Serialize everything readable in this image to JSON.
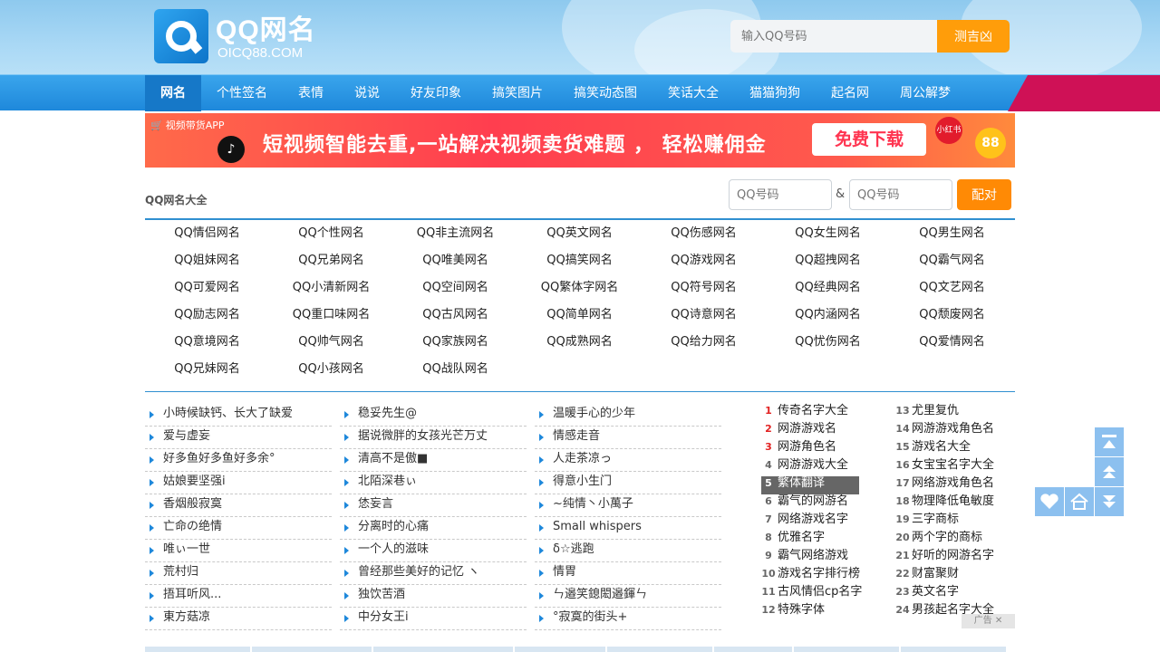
{
  "header": {
    "logo_title": "QQ网名",
    "logo_sub": "OICQ88.COM",
    "search_placeholder": "输入QQ号码",
    "search_button": "测吉凶"
  },
  "nav": {
    "items": [
      "网名",
      "个性签名",
      "表情",
      "说说",
      "好友印象",
      "搞笑图片",
      "搞笑动态图",
      "笑话大全",
      "猫猫狗狗",
      "起名网",
      "周公解梦"
    ],
    "active_index": 0
  },
  "banner": {
    "tag": "视频带货APP",
    "text": "短视频智能去重,一站解决视频卖货难题 ， 轻松赚佣金",
    "button": "免费下载",
    "badge": "小红书"
  },
  "pair": {
    "title": "QQ网名大全",
    "input1_placeholder": "QQ号码",
    "amp": "&",
    "input2_placeholder": "QQ号码",
    "button": "配对"
  },
  "categories": [
    "QQ情侣网名",
    "QQ个性网名",
    "QQ非主流网名",
    "QQ英文网名",
    "QQ伤感网名",
    "QQ女生网名",
    "QQ男生网名",
    "QQ姐妹网名",
    "QQ兄弟网名",
    "QQ唯美网名",
    "QQ搞笑网名",
    "QQ游戏网名",
    "QQ超拽网名",
    "QQ霸气网名",
    "QQ可爱网名",
    "QQ小清新网名",
    "QQ空间网名",
    "QQ繁体字网名",
    "QQ符号网名",
    "QQ经典网名",
    "QQ文艺网名",
    "QQ励志网名",
    "QQ重口味网名",
    "QQ古风网名",
    "QQ简单网名",
    "QQ诗意网名",
    "QQ内涵网名",
    "QQ颓废网名",
    "QQ意境网名",
    "QQ帅气网名",
    "QQ家族网名",
    "QQ成熟网名",
    "QQ给力网名",
    "QQ忧伤网名",
    "QQ爱情网名",
    "QQ兄妹网名",
    "QQ小孩网名",
    "QQ战队网名"
  ],
  "list_col1": [
    "小時候缺钙、长大了缺爱",
    "爱与虚妄",
    "好多鱼好多鱼好多余°",
    "姑娘要坚强i",
    "香烟般寂寞",
    "亡命の绝情",
    "唯ぃ一世",
    "荒村归",
    "捂耳听风...",
    "東方菇凉"
  ],
  "list_col2": [
    "稳妥先生@",
    "据说微胖的女孩光芒万丈",
    "清高不是傲■",
    "北陌深巷ぃ",
    "恷妄言",
    "分离时的心痛",
    "一个人的滋味",
    "曾经那些美好的记忆 ヽ",
    "独饮苦酒",
    "中分女王i"
  ],
  "list_col3": [
    "温暖手心的少年",
    "情感走音",
    "人走茶凉っ",
    "得意小生门",
    "~纯情丶小萬子",
    "Small whispers",
    "δ☆逃跑",
    "情胃",
    "ㄣ邉笑鎴閎邉鍕ㄣ",
    "°寂寞的街头+"
  ],
  "rank_left": [
    {
      "n": "1",
      "t": "传奇名字大全"
    },
    {
      "n": "2",
      "t": "网游游戏名"
    },
    {
      "n": "3",
      "t": "网游角色名"
    },
    {
      "n": "4",
      "t": "网游游戏大全"
    },
    {
      "n": "5",
      "t": "繁体翻译"
    },
    {
      "n": "6",
      "t": "霸气的网游名"
    },
    {
      "n": "7",
      "t": "网络游戏名字"
    },
    {
      "n": "8",
      "t": "优雅名字"
    },
    {
      "n": "9",
      "t": "霸气网络游戏"
    },
    {
      "n": "10",
      "t": "游戏名字排行榜"
    },
    {
      "n": "11",
      "t": "古风情侣cp名字"
    },
    {
      "n": "12",
      "t": "特殊字体"
    }
  ],
  "rank_right": [
    {
      "n": "13",
      "t": "尤里复仇"
    },
    {
      "n": "14",
      "t": "网游游戏角色名"
    },
    {
      "n": "15",
      "t": "游戏名大全"
    },
    {
      "n": "16",
      "t": "女宝宝名字大全"
    },
    {
      "n": "17",
      "t": "网络游戏角色名"
    },
    {
      "n": "18",
      "t": "物理降低龟敏度"
    },
    {
      "n": "19",
      "t": "三字商标"
    },
    {
      "n": "20",
      "t": "两个字的商标"
    },
    {
      "n": "21",
      "t": "好听的网游名字"
    },
    {
      "n": "22",
      "t": "财富聚财"
    },
    {
      "n": "23",
      "t": "英文名字"
    },
    {
      "n": "24",
      "t": "男孩起名字大全"
    }
  ],
  "ad_mark": "广告",
  "colors": {
    "accent": "#1e88db",
    "orange": "#ff8a05",
    "pink": "#cf1156",
    "highlight": "#666666"
  }
}
